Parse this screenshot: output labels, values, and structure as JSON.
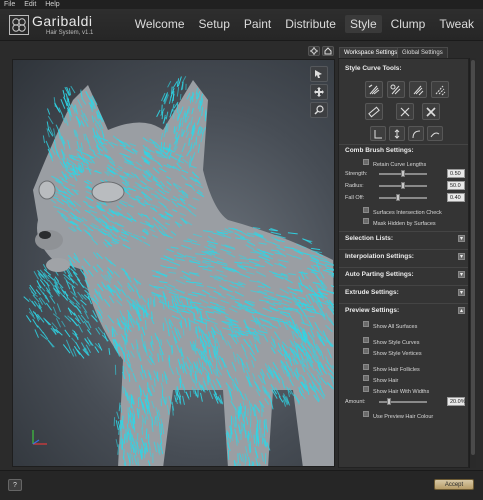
{
  "menu": [
    "File",
    "Edit",
    "Help"
  ],
  "app": {
    "title": "Garibaldi",
    "subtitle": "Hair System,   v1.1"
  },
  "nav": [
    "Welcome",
    "Setup",
    "Paint",
    "Distribute",
    "Style",
    "Clump",
    "Tweak"
  ],
  "nav_active": "Style",
  "tabs": {
    "workspace": "Workspace Settings",
    "global": "Global Settings"
  },
  "panel": {
    "style_curve_tools": "Style Curve Tools:",
    "comb_brush_settings": "Comb Brush Settings:",
    "retain_curve_lengths": "Retain Curve Lengths",
    "strength": {
      "label": "Strength:",
      "value": "0.50",
      "fraction": 0.5
    },
    "radius": {
      "label": "Radius:",
      "value": "50.0",
      "fraction": 0.5
    },
    "falloff": {
      "label": "Fall Off:",
      "value": "0.40",
      "fraction": 0.4
    },
    "surface_intersection_check": "Surfaces Intersection Check",
    "mask_hidden_by_surfaces": "Mask Hidden by Surfaces",
    "selection_lists": "Selection Lists:",
    "interpolation_settings": "Interpolation Settings:",
    "auto_parting_settings": "Auto Parting Settings:",
    "extrude_settings": "Extrude Settings:",
    "preview_settings": "Preview Settings:",
    "show_all_surfaces": "Show All Surfaces",
    "show_style_curves": "Show Style Curves",
    "show_style_vertices": "Show Style Vertices",
    "show_hair_follicles": "Show Hair Follicles",
    "show_hair": "Show Hair",
    "show_hair_with_widths": "Show Hair With Widths",
    "amount": {
      "label": "Amount:",
      "value": "20.0%",
      "fraction": 0.2
    },
    "use_preview_hair_colour": "Use Preview Hair Colour"
  },
  "footer": {
    "help": "?",
    "accept": "Accept"
  },
  "colors": {
    "hair": "#2fd6e6",
    "accent": "#c8b27e"
  }
}
